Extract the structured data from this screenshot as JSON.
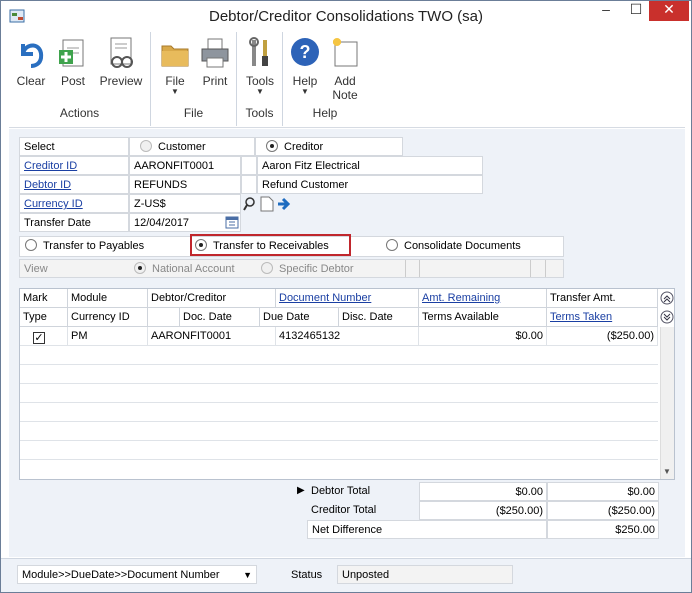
{
  "window": {
    "title": "Debtor/Creditor Consolidations  TWO (sa)",
    "controls": {
      "minimize": "–",
      "maximize": "☐",
      "close": "✕"
    }
  },
  "ribbon": {
    "groups": [
      {
        "title": "Actions",
        "buttons": [
          {
            "label": "Clear",
            "icon": "undo-arrow-icon"
          },
          {
            "label": "Post",
            "icon": "post-icon"
          },
          {
            "label": "Preview",
            "icon": "preview-icon"
          }
        ]
      },
      {
        "title": "File",
        "buttons": [
          {
            "label": "File",
            "icon": "folder-icon"
          },
          {
            "label": "Print",
            "icon": "printer-icon"
          }
        ]
      },
      {
        "title": "Tools",
        "buttons": [
          {
            "label": "Tools",
            "icon": "tools-icon"
          }
        ]
      },
      {
        "title": "Help",
        "buttons": [
          {
            "label": "Help",
            "icon": "help-icon"
          },
          {
            "label": "Add\nNote",
            "icon": "add-note-icon"
          }
        ]
      }
    ]
  },
  "form": {
    "select_label": "Select",
    "customer_label": "Customer",
    "creditor_label": "Creditor",
    "creditor_id_label": "Creditor ID",
    "creditor_id_value": "AARONFIT0001",
    "creditor_name": "Aaron Fitz Electrical",
    "debtor_id_label": "Debtor ID",
    "debtor_id_value": "REFUNDS",
    "debtor_name": "Refund Customer",
    "currency_id_label": "Currency ID",
    "currency_id_value": "Z-US$",
    "transfer_date_label": "Transfer Date",
    "transfer_date_value": "12/04/2017",
    "transfer_to_payables": "Transfer to Payables",
    "transfer_to_receivables": "Transfer to Receivables",
    "consolidate_documents": "Consolidate Documents",
    "view_label": "View",
    "national_account": "National Account",
    "specific_debtor": "Specific Debtor"
  },
  "grid": {
    "headers_row1": [
      "Mark",
      "Module",
      "Debtor/Creditor",
      "Document Number",
      "Amt. Remaining",
      "Transfer Amt."
    ],
    "headers_row2": [
      "Type",
      "Currency ID",
      "Doc. Date",
      "Due Date",
      "Disc. Date",
      "Terms Available",
      "Terms Taken"
    ],
    "rows": [
      {
        "mark": "✓",
        "module": "PM",
        "debtor_creditor": "AARONFIT0001",
        "document_number": "4132465132",
        "amt_remaining": "$0.00",
        "transfer_amt": "($250.00)"
      }
    ]
  },
  "totals": {
    "debtor_total_label": "Debtor Total",
    "debtor_total_1": "$0.00",
    "debtor_total_2": "$0.00",
    "creditor_total_label": "Creditor Total",
    "creditor_total_1": "($250.00)",
    "creditor_total_2": "($250.00)",
    "net_difference_label": "Net Difference",
    "net_difference": "$250.00"
  },
  "footer": {
    "sort_value": "Module>>DueDate>>Document Number",
    "status_label": "Status",
    "status_value": "Unposted"
  }
}
